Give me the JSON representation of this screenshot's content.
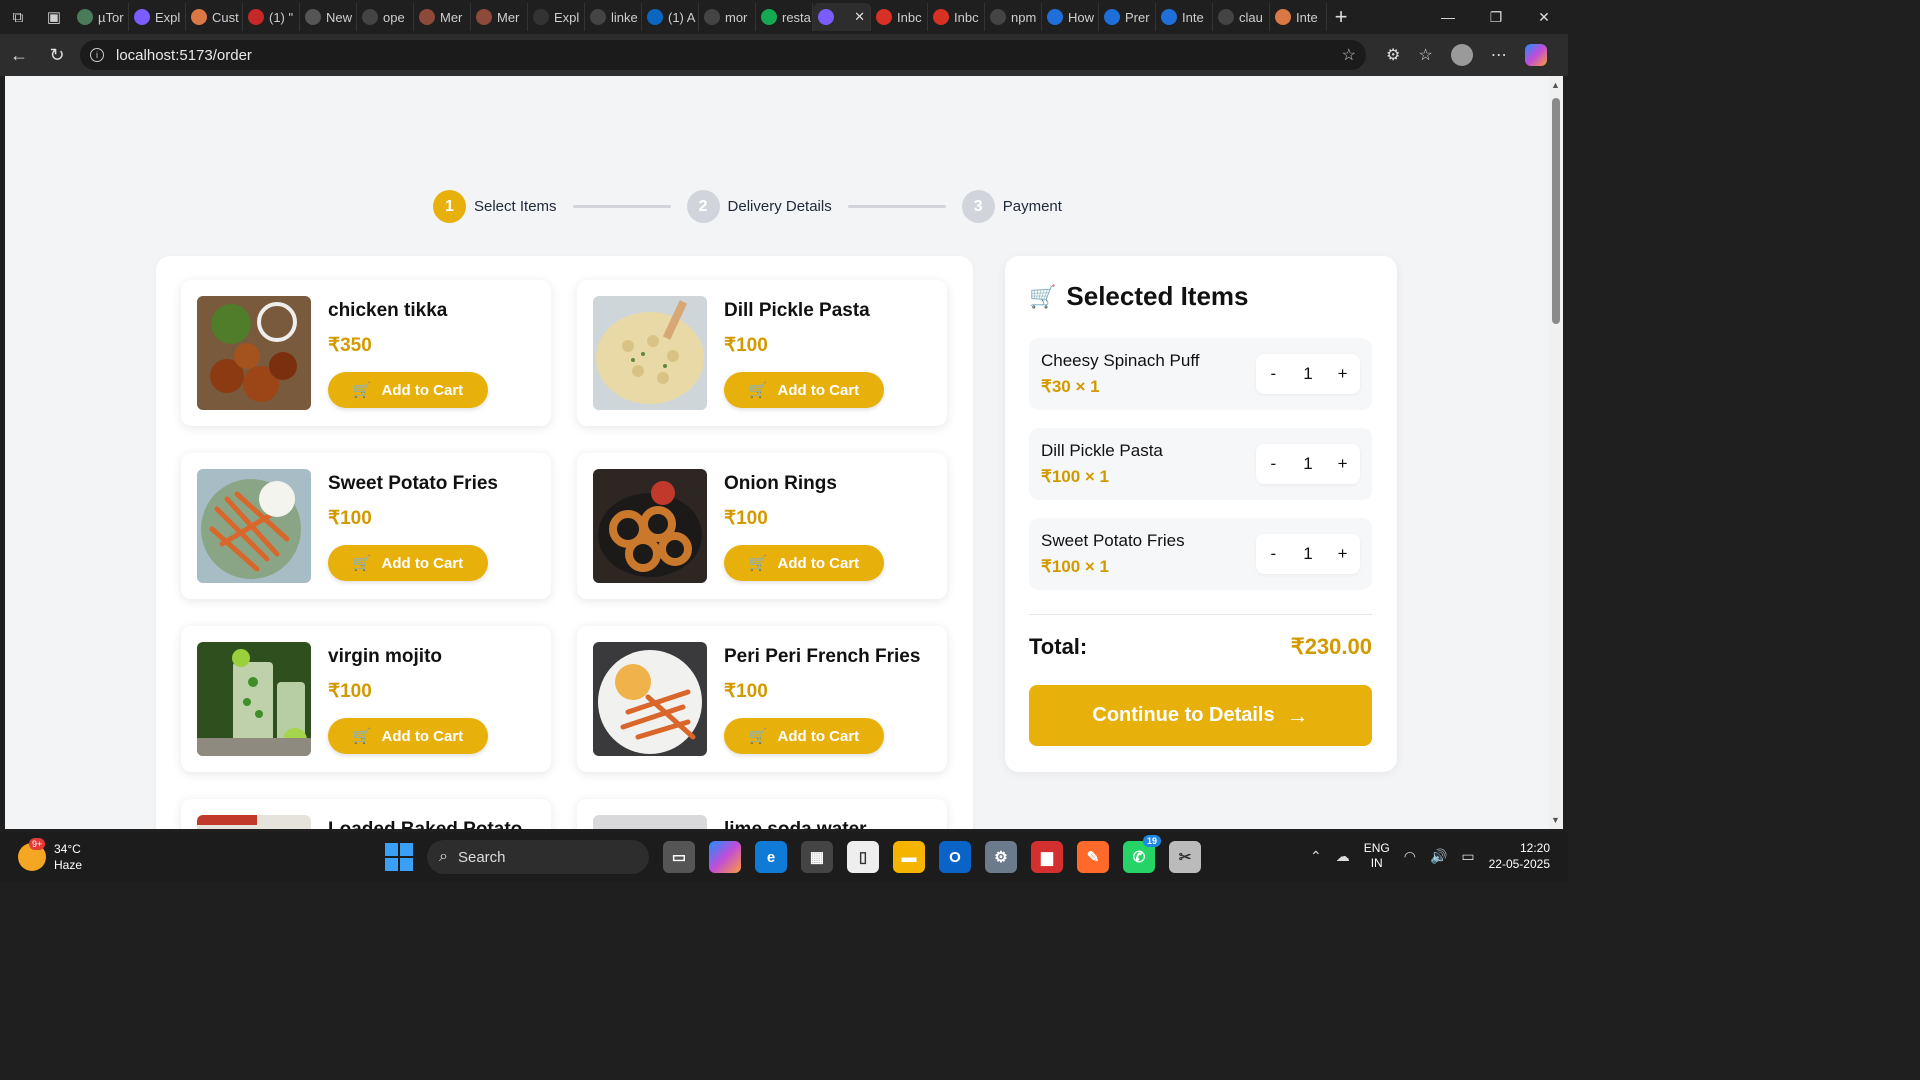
{
  "browser": {
    "tabs": [
      {
        "label": "µTor",
        "color": "#4a7c59"
      },
      {
        "label": "Expl",
        "color": "#7b5cff"
      },
      {
        "label": "Cust",
        "color": "#d97745"
      },
      {
        "label": "(1) \"",
        "color": "#c62828"
      },
      {
        "label": "New",
        "color": "#555555"
      },
      {
        "label": "ope",
        "color": "#444444"
      },
      {
        "label": "Mer",
        "color": "#8d4a3a"
      },
      {
        "label": "Mer",
        "color": "#8d4a3a"
      },
      {
        "label": "Expl",
        "color": "#333333"
      },
      {
        "label": "linke",
        "color": "#444444"
      },
      {
        "label": "(1) A",
        "color": "#0a66c2"
      },
      {
        "label": "mor",
        "color": "#444444"
      },
      {
        "label": "resta",
        "color": "#13aa52"
      },
      {
        "label": "",
        "color": "#7b5cff",
        "active": true
      },
      {
        "label": "Inbc",
        "color": "#d93025"
      },
      {
        "label": "Inbc",
        "color": "#d93025"
      },
      {
        "label": "npm",
        "color": "#444444"
      },
      {
        "label": "How",
        "color": "#1e6fd9"
      },
      {
        "label": "Prer",
        "color": "#1e6fd9"
      },
      {
        "label": "Inte",
        "color": "#1e6fd9"
      },
      {
        "label": "clau",
        "color": "#444444"
      },
      {
        "label": "Inte",
        "color": "#d97745"
      }
    ],
    "url": "localhost:5173/order"
  },
  "steps": [
    {
      "num": "1",
      "label": "Select Items",
      "active": true
    },
    {
      "num": "2",
      "label": "Delivery Details",
      "active": false
    },
    {
      "num": "3",
      "label": "Payment",
      "active": false
    }
  ],
  "menu": {
    "add_label": "Add to Cart",
    "items": [
      {
        "name": "chicken tikka",
        "price": "₹350"
      },
      {
        "name": "Dill Pickle Pasta",
        "price": "₹100"
      },
      {
        "name": "Sweet Potato Fries",
        "price": "₹100"
      },
      {
        "name": "Onion Rings",
        "price": "₹100"
      },
      {
        "name": "virgin mojito",
        "price": "₹100"
      },
      {
        "name": "Peri Peri French Fries",
        "price": "₹100"
      },
      {
        "name": "Loaded Baked Potato",
        "price": ""
      },
      {
        "name": "lime soda water",
        "price": ""
      }
    ]
  },
  "cart": {
    "title": "Selected Items",
    "items": [
      {
        "name": "Cheesy Spinach Puff",
        "price": "₹30 × 1",
        "qty": "1"
      },
      {
        "name": "Dill Pickle Pasta",
        "price": "₹100 × 1",
        "qty": "1"
      },
      {
        "name": "Sweet Potato Fries",
        "price": "₹100 × 1",
        "qty": "1"
      }
    ],
    "minus": "-",
    "plus": "+",
    "total_label": "Total:",
    "total_value": "₹230.00",
    "continue_label": "Continue to Details"
  },
  "taskbar": {
    "weather_temp": "34°C",
    "weather_desc": "Haze",
    "weather_badge": "9+",
    "search_label": "Search",
    "whatsapp_badge": "19",
    "lang_line1": "ENG",
    "lang_line2": "IN",
    "time": "12:20",
    "date": "22-05-2025"
  },
  "colors": {
    "accent": "#e8b00b",
    "price": "#d39a00"
  }
}
